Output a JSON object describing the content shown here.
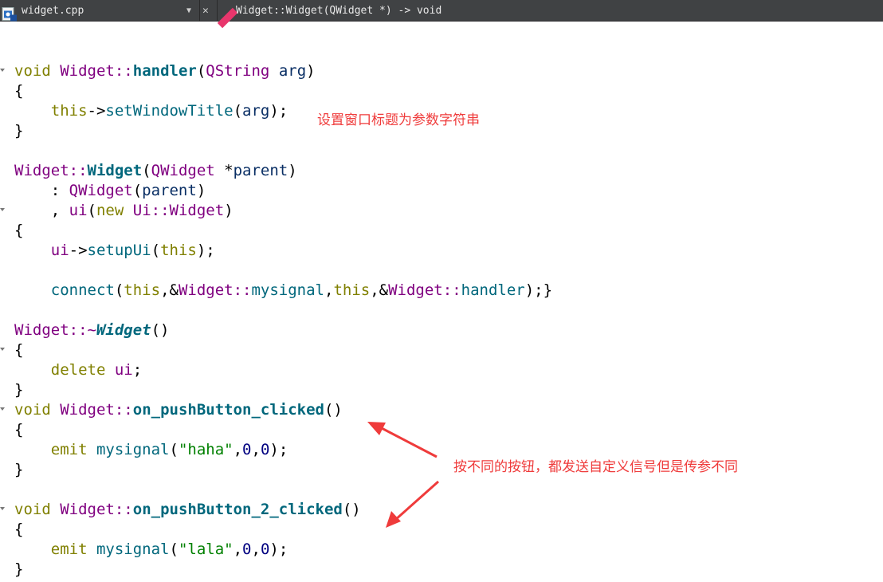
{
  "toolbar": {
    "file_name": "widget.cpp",
    "combo_arrow": "▼",
    "close_glyph": "✕",
    "symbol": "Widget::Widget(QWidget *) -> void"
  },
  "code": {
    "l1": [
      "void",
      "Widget",
      "::",
      "handler",
      "(",
      "QString",
      " ",
      "arg",
      ")"
    ],
    "l2": "{",
    "l3": [
      "    ",
      "this",
      "->",
      "setWindowTitle",
      "(",
      "arg",
      ");"
    ],
    "l4": "}",
    "l6": [
      "Widget",
      "::",
      "Widget",
      "(",
      "QWidget",
      " *",
      "parent",
      ")"
    ],
    "l7": [
      "    : ",
      "QWidget",
      "(",
      "parent",
      ")"
    ],
    "l8": [
      "    , ",
      "ui",
      "(",
      "new",
      " ",
      "Ui",
      "::",
      "Widget",
      ")"
    ],
    "l9": "{",
    "l10": [
      "    ",
      "ui",
      "->",
      "setupUi",
      "(",
      "this",
      ");"
    ],
    "l12": [
      "    ",
      "connect",
      "(",
      "this",
      ",&",
      "Widget",
      "::",
      "mysignal",
      ",",
      "this",
      ",&",
      "Widget",
      "::",
      "handler",
      ");}"
    ],
    "l14": [
      "Widget",
      "::~",
      "Widget",
      "()"
    ],
    "l15": "{",
    "l16": [
      "    ",
      "delete",
      " ",
      "ui",
      ";"
    ],
    "l17": "}",
    "l18": [
      "void",
      " ",
      "Widget",
      "::",
      "on_pushButton_clicked",
      "()"
    ],
    "l19": "{",
    "l20": [
      "    ",
      "emit",
      " ",
      "mysignal",
      "(",
      "\"haha\"",
      ",",
      "0",
      ",",
      "0",
      ");"
    ],
    "l21": "}",
    "l23": [
      "void",
      " ",
      "Widget",
      "::",
      "on_pushButton_2_clicked",
      "()"
    ],
    "l24": "{",
    "l25": [
      "    ",
      "emit",
      " ",
      "mysignal",
      "(",
      "\"lala\"",
      ",",
      "0",
      ",",
      "0",
      ");"
    ],
    "l26": "}"
  },
  "annotations": {
    "title_note": "设置窗口标题为参数字符串",
    "button_note": "按不同的按钮，都发送自定义信号但是传参不同"
  },
  "colors": {
    "keyword": "#808000",
    "class": "#800080",
    "function": "#00677c",
    "string": "#008000",
    "number": "#000080",
    "annotation": "#ef3b3b",
    "toolbar_bg": "#404244"
  }
}
